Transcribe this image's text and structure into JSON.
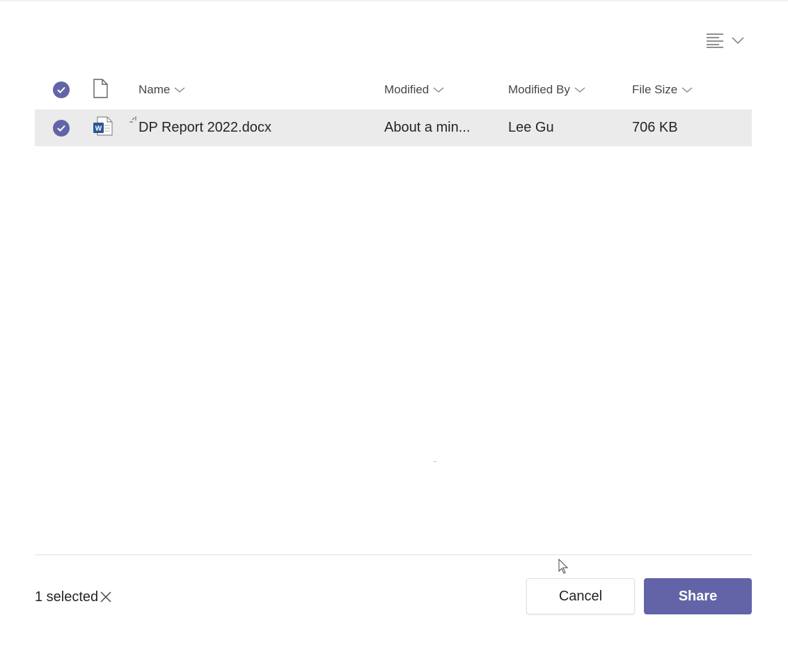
{
  "toolbar": {
    "view_icon": "list-view-icon",
    "chevron_icon": "chevron-down-icon"
  },
  "table": {
    "columns": [
      {
        "key": "select",
        "icon": "check-circle-icon"
      },
      {
        "key": "type",
        "icon": "document-icon"
      },
      {
        "key": "name",
        "label": "Name"
      },
      {
        "key": "modified",
        "label": "Modified"
      },
      {
        "key": "modified_by",
        "label": "Modified By"
      },
      {
        "key": "file_size",
        "label": "File Size"
      }
    ],
    "rows": [
      {
        "selected": true,
        "file_icon": "word-file-icon",
        "name": "DP Report 2022.docx",
        "modified": "About a min...",
        "modified_by": "Lee Gu",
        "file_size": "706 KB"
      }
    ]
  },
  "footer": {
    "selection_text": "1 selected",
    "clear_icon": "close-icon",
    "cancel_label": "Cancel",
    "share_label": "Share"
  },
  "colors": {
    "accent": "#6264a7",
    "row_selected_bg": "#ebebeb",
    "word_blue": "#2b579a"
  }
}
